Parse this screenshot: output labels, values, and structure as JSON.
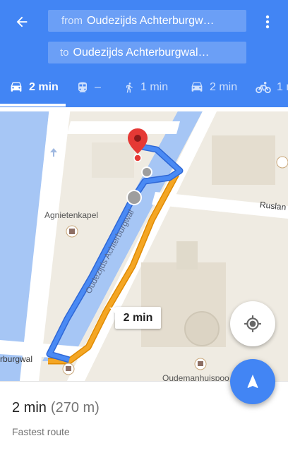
{
  "header": {
    "from_label": "from",
    "from_value": "Oudezijds Achterburgw…",
    "to_label": "to",
    "to_value": "Oudezijds Achterburgwal…"
  },
  "modes": [
    {
      "name": "drive",
      "icon": "car-icon",
      "label": "2 min",
      "active": true
    },
    {
      "name": "transit",
      "icon": "train-icon",
      "label": "–",
      "active": false
    },
    {
      "name": "walk",
      "icon": "walk-icon",
      "label": "1 min",
      "active": false
    },
    {
      "name": "taxi",
      "icon": "car-icon",
      "label": "2 min",
      "active": false
    },
    {
      "name": "bike",
      "icon": "bike-icon",
      "label": "1 m",
      "active": false
    }
  ],
  "map": {
    "route_time": "2 min",
    "labels": {
      "agnietenkapel": "Agnietenkapel",
      "canal_name": "Oudezijds Achterburgwal",
      "canal_left": "rburgwal",
      "ruslan": "Ruslan",
      "oudemanhuispoort": "Oudemanhuispoo"
    }
  },
  "summary": {
    "duration": "2 min",
    "distance": "(270 m)",
    "subtitle": "Fastest route"
  },
  "colors": {
    "primary": "#4285f4",
    "route_main": "#4285f4",
    "route_alt": "#f2a200"
  }
}
